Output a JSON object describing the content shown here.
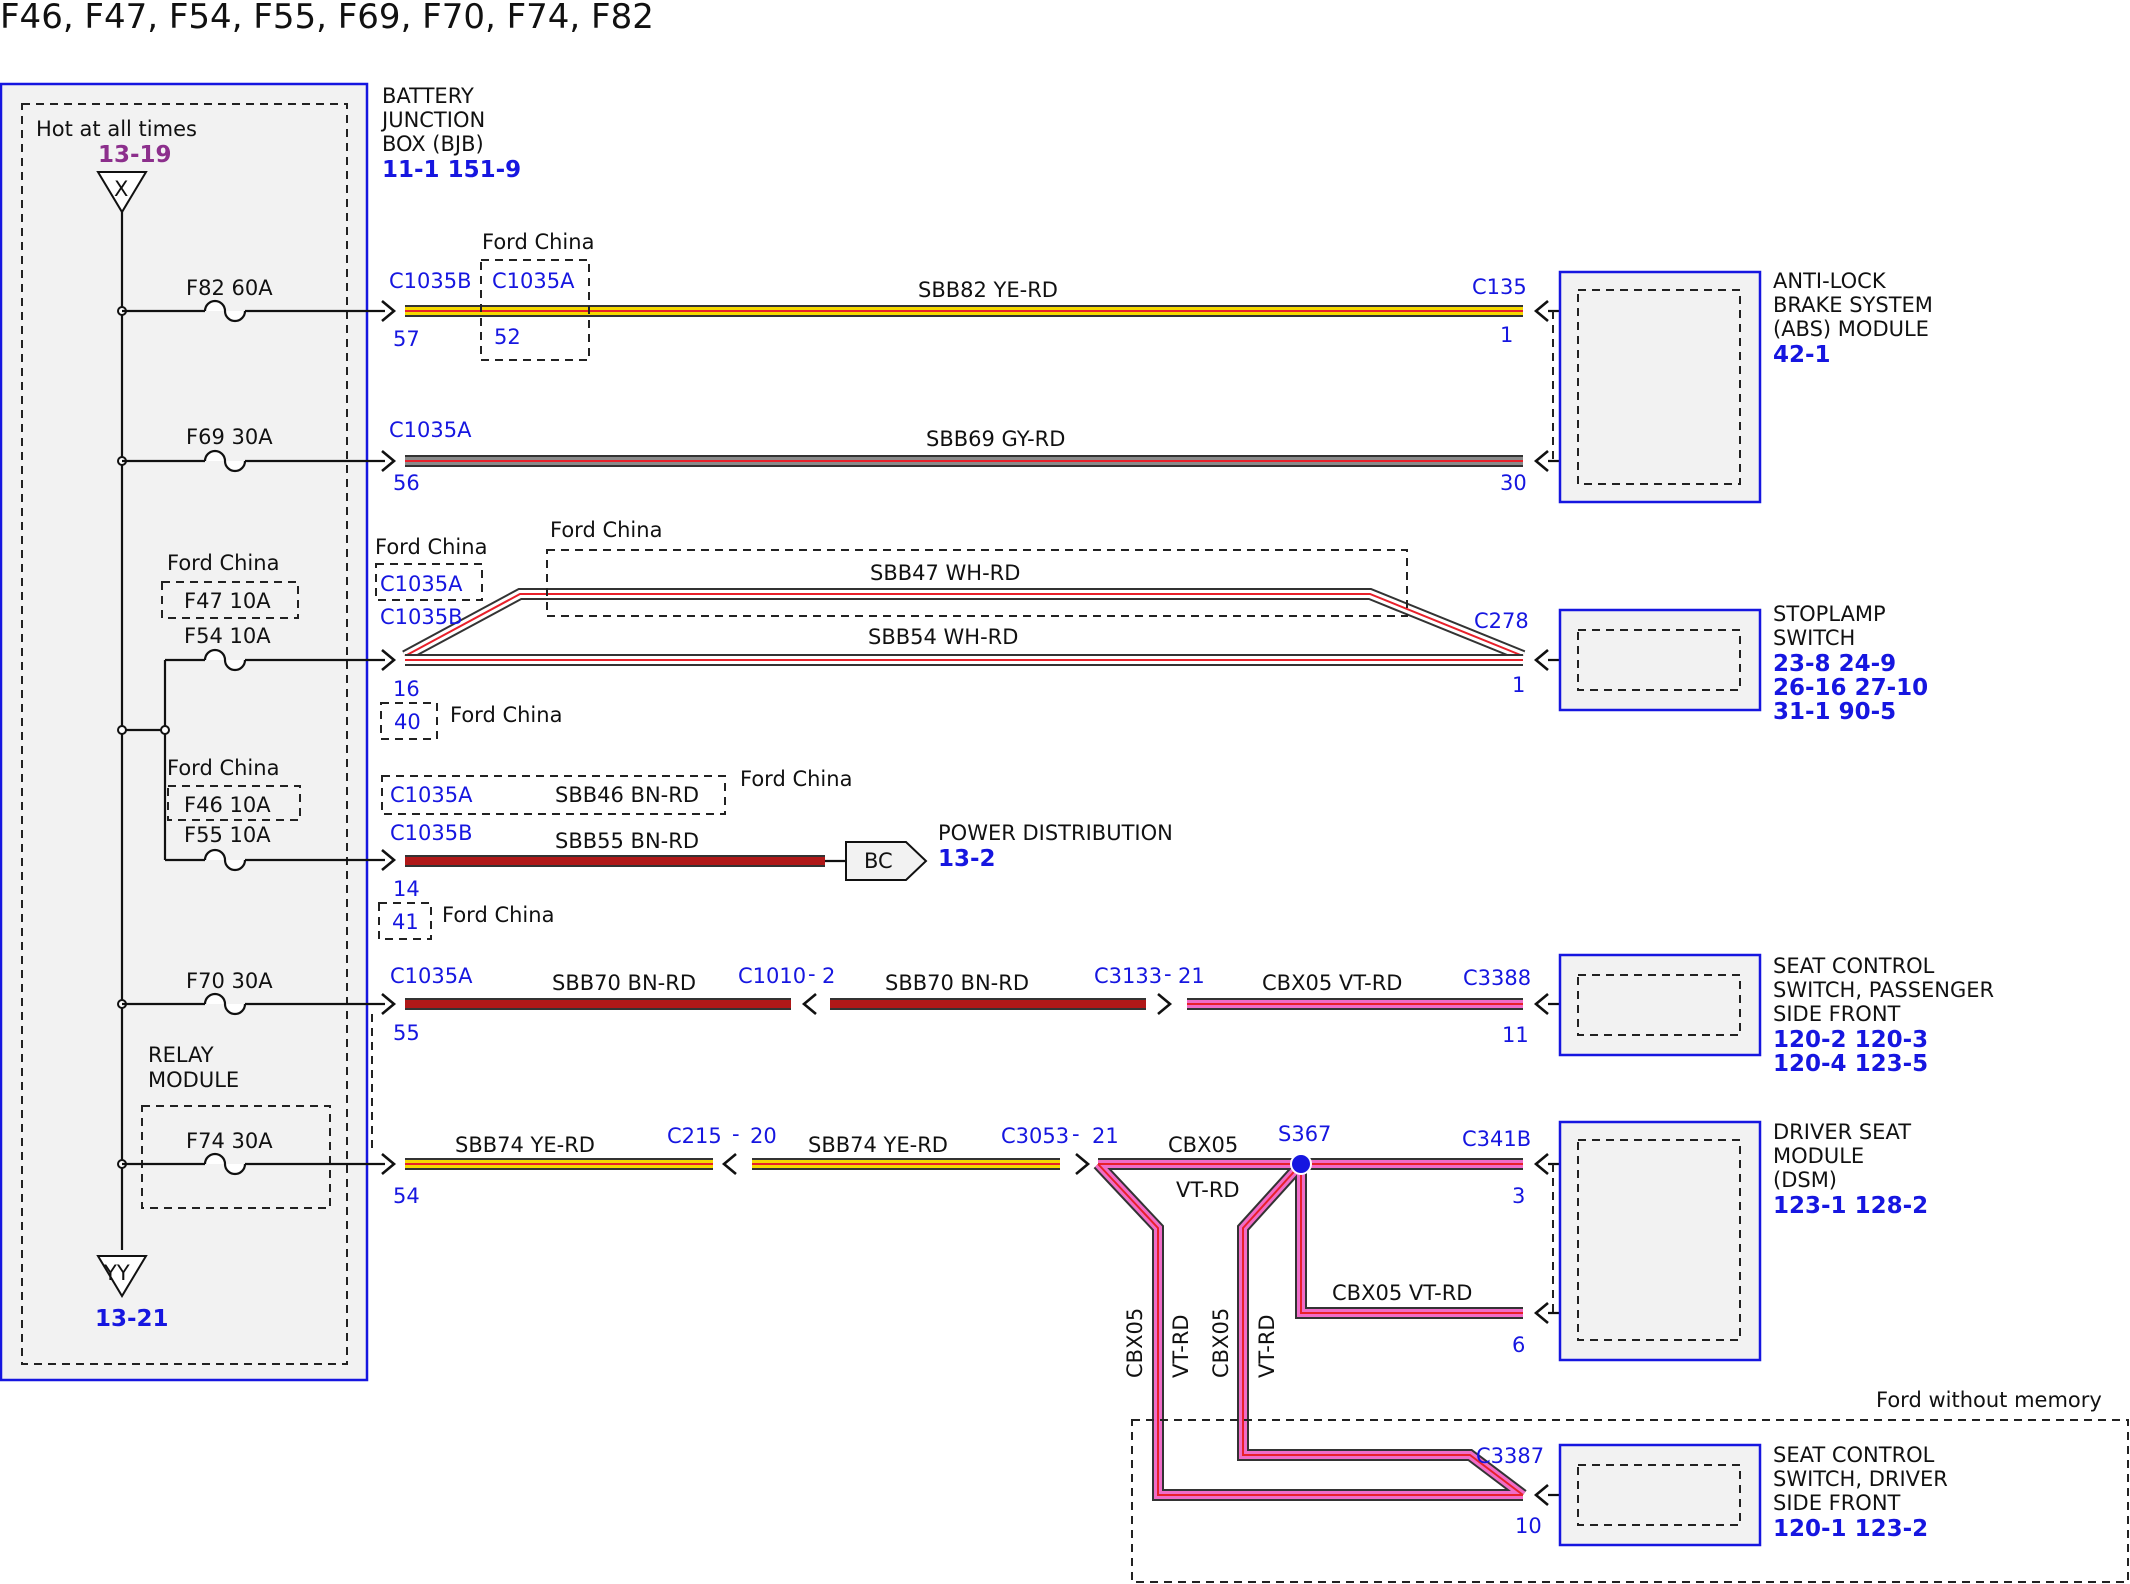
{
  "title": "F46, F47, F54, F55, F69, F70, F74, F82",
  "colors": {
    "blue": "#1616e0",
    "yellow": "#f5d800",
    "red": "#e8202a",
    "gray": "#8a8a8a",
    "brown": "#b01818",
    "violet": "#f06cc8",
    "white": "#ffffff"
  },
  "bjb": {
    "lines": [
      "BATTERY",
      "JUNCTION",
      "BOX (BJB)"
    ],
    "refs": "11-1   151-9",
    "hot_label": "Hot at all times",
    "hot_ref": "13-19",
    "hot_symbol": "X",
    "ground_symbol": "YY",
    "ground_ref": "13-21",
    "relay_label": [
      "RELAY",
      "MODULE"
    ]
  },
  "fuses": {
    "f82": "F82  60A",
    "f69": "F69  30A",
    "f47": "F47  10A",
    "f54": "F54  10A",
    "f46": "F46  10A",
    "f55": "F55  10A",
    "f70": "F70  30A",
    "f74": "F74  30A"
  },
  "ford_china": "Ford China",
  "ford_without_memory": "Ford without memory",
  "circuits": {
    "sbb82": "SBB82   YE-RD",
    "sbb69": "SBB69  GY-RD",
    "sbb47": "SBB47  WH-RD",
    "sbb54": "SBB54  WH-RD",
    "sbb46": "SBB46  BN-RD",
    "sbb55": "SBB55  BN-RD",
    "sbb70": "SBB70  BN-RD",
    "sbb74": "SBB74  YE-RD",
    "cbx05": "CBX05",
    "cbx05_full": "CBX05  VT-RD",
    "vt_rd": "VT-RD"
  },
  "connectors": {
    "c1035b": "C1035B",
    "c1035a": "C1035A",
    "c135": "C135",
    "c278": "C278",
    "c1010": "C1010",
    "c3133": "C3133",
    "c3388": "C3388",
    "c215": "C215",
    "c3053": "C3053",
    "c341b": "C341B",
    "c3387": "C3387",
    "s367": "S367",
    "dash": "-"
  },
  "pins": {
    "p57": "57",
    "p52": "52",
    "p1": "1",
    "p56": "56",
    "p30": "30",
    "p16": "16",
    "p40": "40",
    "p14": "14",
    "p41": "41",
    "p55": "55",
    "p2": "2",
    "p21": "21",
    "p11": "11",
    "p54": "54",
    "p20": "20",
    "p3": "3",
    "p6": "6",
    "p10": "10"
  },
  "bc": {
    "label": "BC",
    "text": "POWER DISTRIBUTION",
    "ref": "13-2"
  },
  "modules": {
    "abs": {
      "lines": [
        "ANTI-LOCK",
        "BRAKE SYSTEM",
        "(ABS) MODULE"
      ],
      "refs": [
        "42-1"
      ]
    },
    "stoplamp": {
      "lines": [
        "STOPLAMP",
        "SWITCH"
      ],
      "refs": [
        "23-8   24-9",
        "26-16 27-10",
        "31-1   90-5"
      ]
    },
    "pass_seat": {
      "lines": [
        "SEAT CONTROL",
        "SWITCH, PASSENGER",
        "SIDE FRONT"
      ],
      "refs": [
        "120-2 120-3",
        "120-4 123-5"
      ]
    },
    "dsm": {
      "lines": [
        "DRIVER SEAT",
        "MODULE",
        "(DSM)"
      ],
      "refs": [
        "123-1 128-2"
      ]
    },
    "drv_seat": {
      "lines": [
        "SEAT CONTROL",
        "SWITCH, DRIVER",
        "SIDE FRONT"
      ],
      "refs": [
        "120-1 123-2"
      ]
    }
  }
}
